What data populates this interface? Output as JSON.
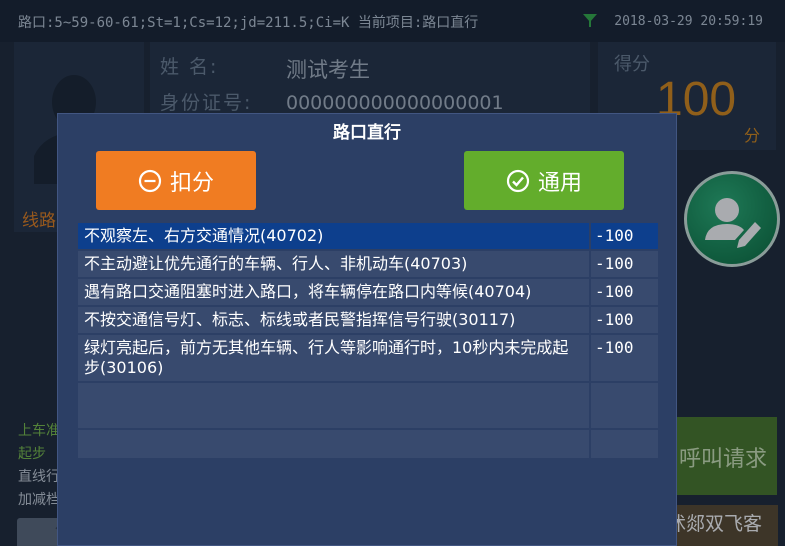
{
  "status": {
    "info": "路口:5~59-60-61;St=1;Cs=12;jd=211.5;Ci=K 当前项目:路口直行",
    "datetime": "2018-03-29 20:59:19"
  },
  "candidate": {
    "name_label": "姓    名:",
    "name": "测试考生",
    "id_label": "身份证号:",
    "id": "000000000000000001"
  },
  "score": {
    "title": "得分",
    "value": "100",
    "unit": "分"
  },
  "side": {
    "route_label": "线路",
    "line1": "上车准",
    "line2": "起步",
    "line3": "直线行",
    "line4": "加减档"
  },
  "call_button": "呼叫请求",
  "watermark": "头条 @沭郯双飞客",
  "bottom_keys": [
    "",
    "",
    "",
    "",
    "",
    "P"
  ],
  "dialog": {
    "title": "路口直行",
    "deduct_label": "扣分",
    "pass_label": "通用",
    "items": [
      {
        "text": "不观察左、右方交通情况(40702)",
        "score": "-100"
      },
      {
        "text": "不主动避让优先通行的车辆、行人、非机动车(40703)",
        "score": "-100"
      },
      {
        "text": "遇有路口交通阻塞时进入路口，将车辆停在路口内等候(40704)",
        "score": "-100"
      },
      {
        "text": "不按交通信号灯、标志、标线或者民警指挥信号行驶(30117)",
        "score": "-100"
      },
      {
        "text": "绿灯亮起后，前方无其他车辆、行人等影响通行时，10秒内未完成起步(30106)",
        "score": "-100"
      }
    ]
  },
  "colors": {
    "deduct": "#f07c22",
    "pass": "#63ad2c",
    "selected_row": "#0d3f8d",
    "score": "#d98a1b"
  }
}
